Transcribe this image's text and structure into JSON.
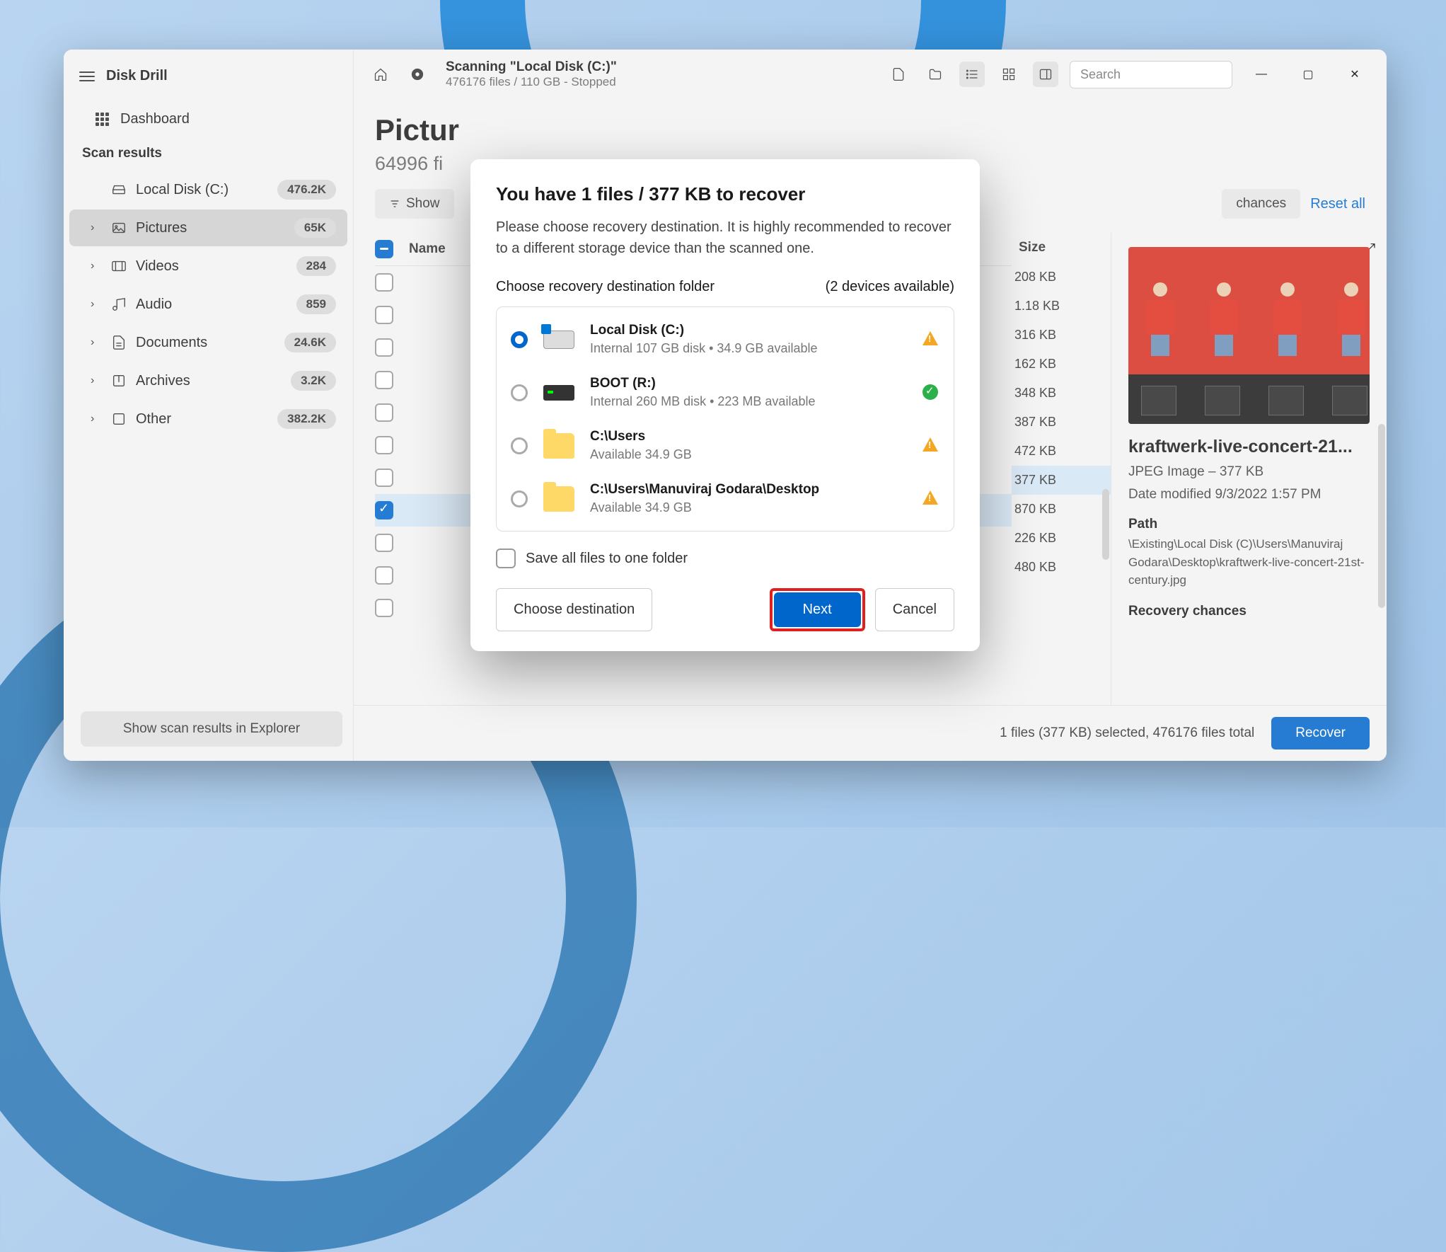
{
  "app": {
    "name": "Disk Drill"
  },
  "sidebar": {
    "dashboard": "Dashboard",
    "section": "Scan results",
    "disk": {
      "label": "Local Disk (C:)",
      "badge": "476.2K"
    },
    "categories": [
      {
        "label": "Pictures",
        "badge": "65K",
        "active": true,
        "icon": "image"
      },
      {
        "label": "Videos",
        "badge": "284",
        "icon": "video"
      },
      {
        "label": "Audio",
        "badge": "859",
        "icon": "audio"
      },
      {
        "label": "Documents",
        "badge": "24.6K",
        "icon": "document"
      },
      {
        "label": "Archives",
        "badge": "3.2K",
        "icon": "archive"
      },
      {
        "label": "Other",
        "badge": "382.2K",
        "icon": "other"
      }
    ],
    "explorer_button": "Show scan results in Explorer"
  },
  "header": {
    "scan_title": "Scanning \"Local Disk (C:)\"",
    "scan_sub": "476176 files / 110 GB - Stopped",
    "search_placeholder": "Search"
  },
  "page": {
    "title": "Pictur",
    "subtitle": "64996 fi"
  },
  "filters": {
    "show": "Show",
    "chances": "chances",
    "reset": "Reset all"
  },
  "table": {
    "name_header": "Name",
    "size_header": "Size",
    "sizes": [
      "208 KB",
      "1.18 KB",
      "316 KB",
      "162 KB",
      "348 KB",
      "387 KB",
      "472 KB",
      "377 KB",
      "870 KB",
      "226 KB",
      "480 KB"
    ]
  },
  "preview": {
    "filename": "kraftwerk-live-concert-21...",
    "type_size": "JPEG Image – 377 KB",
    "modified": "Date modified 9/3/2022 1:57 PM",
    "path_label": "Path",
    "path": "\\Existing\\Local Disk (C)\\Users\\Manuviraj Godara\\Desktop\\kraftwerk-live-concert-21st-century.jpg",
    "chances_label": "Recovery chances"
  },
  "footer": {
    "status": "1 files (377 KB) selected, 476176 files total",
    "recover": "Recover"
  },
  "dialog": {
    "title": "You have 1 files / 377 KB to recover",
    "text": "Please choose recovery destination. It is highly recommended to recover to a different storage device than the scanned one.",
    "choose_label": "Choose recovery destination folder",
    "devices": "(2 devices available)",
    "destinations": [
      {
        "name": "Local Disk (C:)",
        "detail": "Internal 107 GB disk • 34.9 GB available",
        "icon": "sysdisk",
        "status": "warn",
        "selected": true
      },
      {
        "name": "BOOT (R:)",
        "detail": "Internal 260 MB disk • 223 MB available",
        "icon": "darkdisk",
        "status": "ok",
        "selected": false
      },
      {
        "name": "C:\\Users",
        "detail": "Available 34.9 GB",
        "icon": "folder",
        "status": "warn",
        "selected": false
      },
      {
        "name": "C:\\Users\\Manuviraj Godara\\Desktop",
        "detail": "Available 34.9 GB",
        "icon": "folder",
        "status": "warn",
        "selected": false
      }
    ],
    "save_one": "Save all files to one folder",
    "choose_btn": "Choose destination",
    "next": "Next",
    "cancel": "Cancel"
  }
}
